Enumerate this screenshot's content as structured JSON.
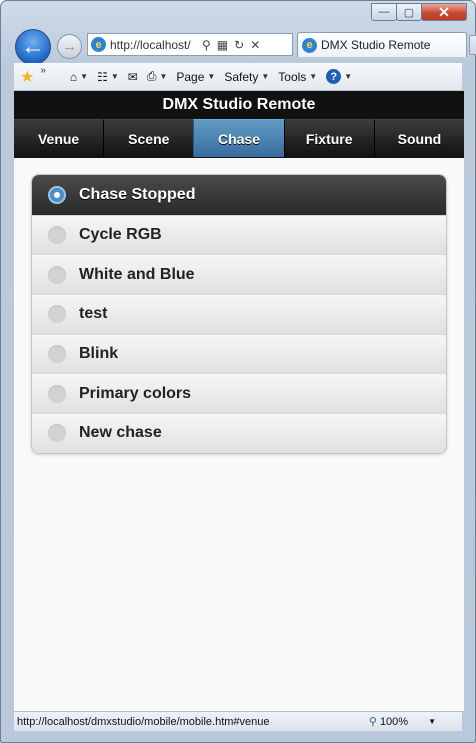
{
  "window": {
    "buttons": {
      "minimize": "—",
      "maximize": "▢",
      "close": "✕"
    }
  },
  "browser": {
    "address": "http://localhost/",
    "tab_title": "DMX Studio Remote",
    "commands": {
      "page": "Page",
      "safety": "Safety",
      "tools": "Tools"
    }
  },
  "app": {
    "title": "DMX Studio Remote",
    "nav": [
      {
        "label": "Venue",
        "active": false
      },
      {
        "label": "Scene",
        "active": false
      },
      {
        "label": "Chase",
        "active": true
      },
      {
        "label": "Fixture",
        "active": false
      },
      {
        "label": "Sound",
        "active": false
      }
    ],
    "chases": [
      {
        "label": "Chase Stopped",
        "selected": true
      },
      {
        "label": "Cycle RGB",
        "selected": false
      },
      {
        "label": "White and Blue",
        "selected": false
      },
      {
        "label": "test",
        "selected": false
      },
      {
        "label": "Blink",
        "selected": false
      },
      {
        "label": "Primary colors",
        "selected": false
      },
      {
        "label": "New chase",
        "selected": false
      }
    ]
  },
  "status": {
    "url": "http://localhost/dmxstudio/mobile/mobile.htm#venue",
    "zoom": "100%"
  },
  "colors": {
    "accent": "#4a90c8",
    "header_bg": "#111111"
  }
}
